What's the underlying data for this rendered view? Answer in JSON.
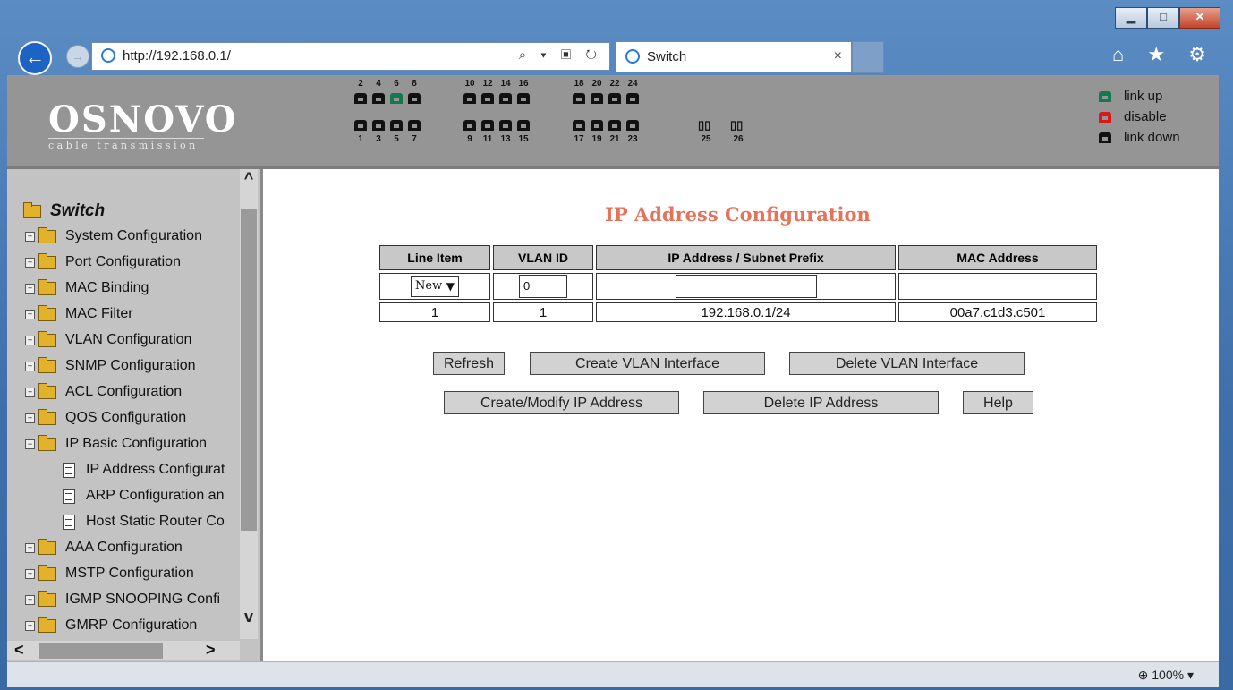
{
  "browser": {
    "window_controls": {
      "minimize": "▁",
      "maximize": "□",
      "close": "✕"
    },
    "back_icon": "arrow-left-icon",
    "forward_icon": "arrow-right-icon",
    "url": "http://192.168.0.1/",
    "address_tools": "⌕ ▾ ▣ ↻",
    "tab_title": "Switch",
    "tab_close": "×",
    "toolbar_icons": "⌂ ★ ⚙",
    "zoom": "100%"
  },
  "header": {
    "logo": "OSNOVO",
    "logo_sub": "cable transmission",
    "port_top_labels": [
      "2",
      "4",
      "6",
      "8",
      "10",
      "12",
      "14",
      "16",
      "18",
      "20",
      "22",
      "24"
    ],
    "port_bottom_labels": [
      "1",
      "3",
      "5",
      "7",
      "9",
      "11",
      "13",
      "15",
      "17",
      "19",
      "21",
      "23",
      "25",
      "26"
    ],
    "port_up": "6",
    "legend": [
      {
        "label": "link up",
        "color": "#127a4f"
      },
      {
        "label": "disable",
        "color": "#d61a1a"
      },
      {
        "label": "link down",
        "color": "#111111"
      }
    ]
  },
  "sidebar": {
    "root": "Switch",
    "items": [
      "System Configuration",
      "Port Configuration",
      "MAC Binding",
      "MAC Filter",
      "VLAN Configuration",
      "SNMP Configuration",
      "ACL Configuration",
      "QOS Configuration",
      "IP Basic Configuration",
      "AAA Configuration",
      "MSTP Configuration",
      "IGMP SNOOPING Confi",
      "GMRP Configuration"
    ],
    "subitems": [
      "IP Address Configurat",
      "ARP Configuration an",
      "Host Static Router Co"
    ],
    "scroll_up": "^",
    "scroll_down": "v",
    "scroll_left": "<",
    "scroll_right": ">"
  },
  "main": {
    "title": "IP Address Configuration",
    "table": {
      "headers": [
        "Line Item",
        "VLAN ID",
        "IP Address / Subnet Prefix",
        "MAC Address"
      ],
      "new_row": {
        "line_item": "New",
        "vlan_id": "0",
        "ip": "",
        "mac": ""
      },
      "rows": [
        {
          "line_item": "1",
          "vlan_id": "1",
          "ip": "192.168.0.1/24",
          "mac": "00a7.c1d3.c501"
        }
      ]
    },
    "buttons": {
      "refresh": "Refresh",
      "create_vlan": "Create VLAN Interface",
      "delete_vlan": "Delete VLAN Interface",
      "create_ip": "Create/Modify IP Address",
      "delete_ip": "Delete IP Address",
      "help": "Help"
    }
  }
}
